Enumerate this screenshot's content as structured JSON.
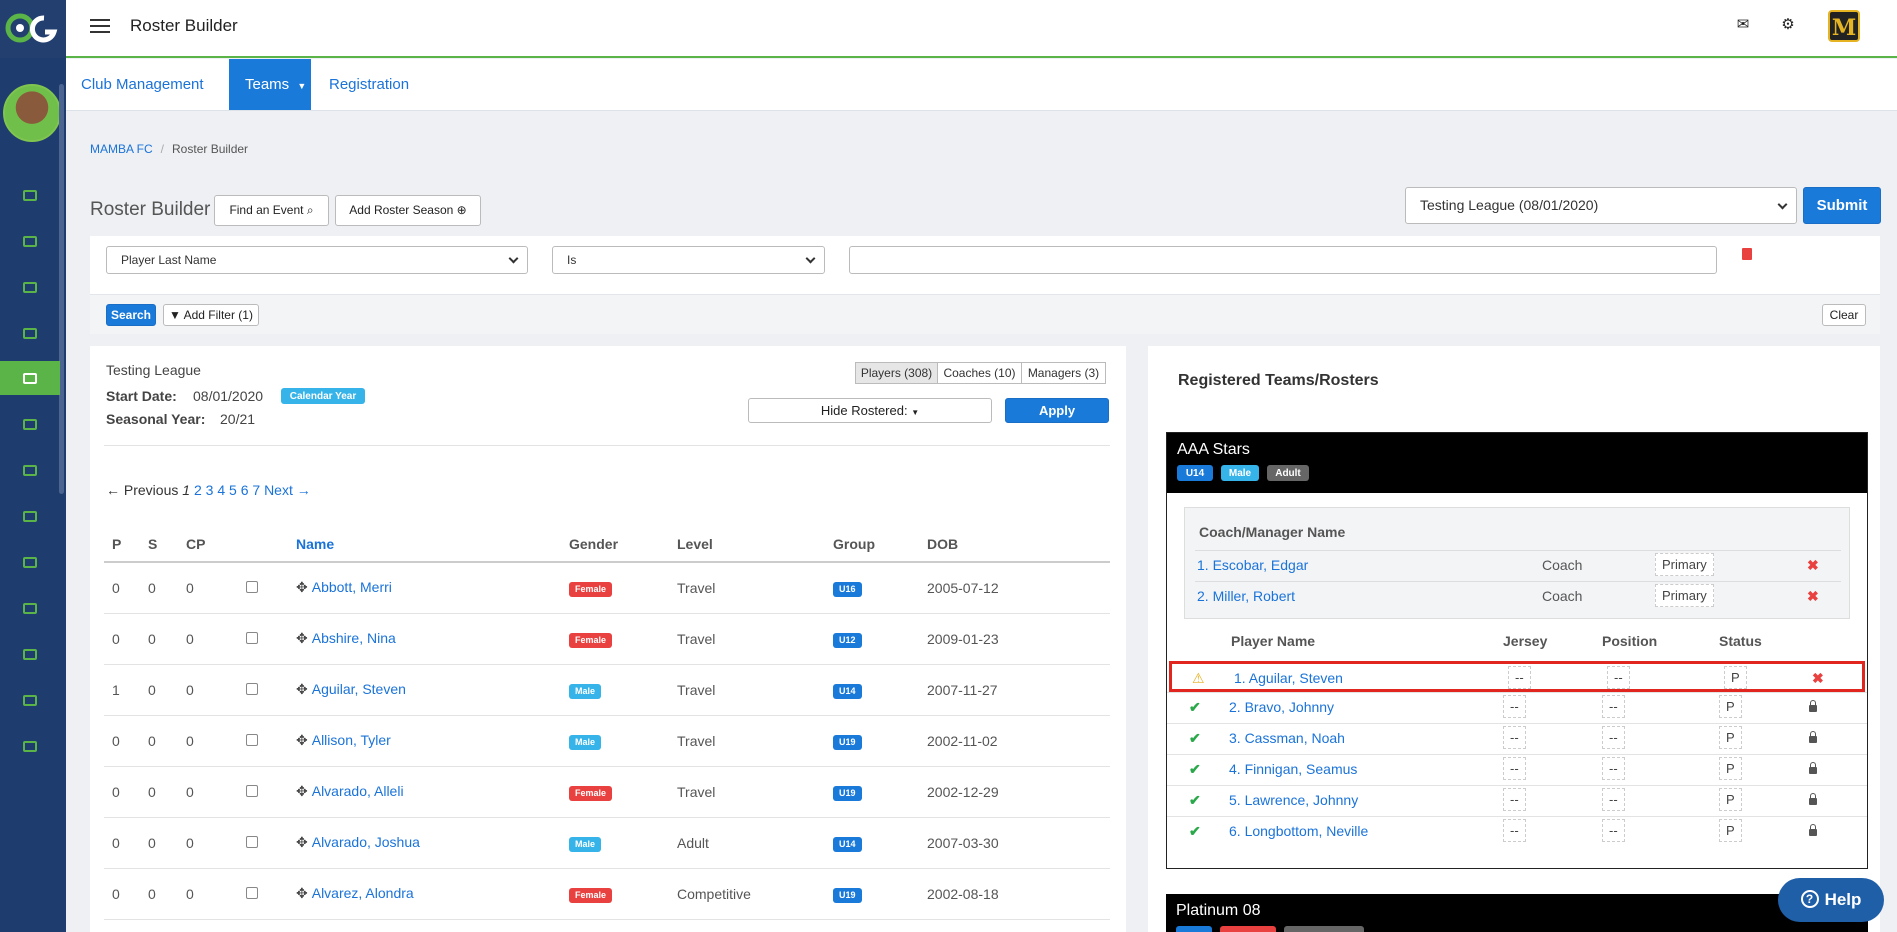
{
  "app": {
    "title": "Roster Builder",
    "brand_letter": "M"
  },
  "tabs": [
    {
      "label": "Club Management"
    },
    {
      "label": "Teams"
    },
    {
      "label": "Registration"
    }
  ],
  "breadcrumb": {
    "root": "MAMBA FC",
    "current": "Roster Builder"
  },
  "heading": {
    "title": "Roster Builder",
    "find_event_label": "Find an Event",
    "add_season_label": "Add Roster Season",
    "league_select": "Testing League (08/01/2020)",
    "submit_label": "Submit"
  },
  "filter": {
    "field": "Player Last Name",
    "operator": "Is",
    "value": "",
    "search_label": "Search",
    "add_filter_label": "Add Filter (1)",
    "clear_label": "Clear"
  },
  "league": {
    "name": "Testing League",
    "start_date_label": "Start Date:",
    "start_date": "08/01/2020",
    "calendar_badge": "Calendar Year",
    "seasonal_year_label": "Seasonal Year:",
    "seasonal_year": "20/21"
  },
  "segments": {
    "players": "Players (308)",
    "coaches": "Coaches (10)",
    "managers": "Managers (3)"
  },
  "hide_rostered": "Hide Rostered:",
  "apply_label": "Apply",
  "pager": {
    "prev": "← Previous",
    "current": "1",
    "pages": [
      "2",
      "3",
      "4",
      "5",
      "6",
      "7"
    ],
    "next": "Next →"
  },
  "players_table": {
    "headers": {
      "p": "P",
      "s": "S",
      "cp": "CP",
      "name": "Name",
      "gender": "Gender",
      "level": "Level",
      "group": "Group",
      "dob": "DOB"
    },
    "rows": [
      {
        "p": "0",
        "s": "0",
        "cp": "0",
        "name": "Abbott, Merri",
        "gender": "Female",
        "level": "Travel",
        "group": "U16",
        "dob": "2005-07-12"
      },
      {
        "p": "0",
        "s": "0",
        "cp": "0",
        "name": "Abshire, Nina",
        "gender": "Female",
        "level": "Travel",
        "group": "U12",
        "dob": "2009-01-23"
      },
      {
        "p": "1",
        "s": "0",
        "cp": "0",
        "name": "Aguilar, Steven",
        "gender": "Male",
        "level": "Travel",
        "group": "U14",
        "dob": "2007-11-27"
      },
      {
        "p": "0",
        "s": "0",
        "cp": "0",
        "name": "Allison, Tyler",
        "gender": "Male",
        "level": "Travel",
        "group": "U19",
        "dob": "2002-11-02"
      },
      {
        "p": "0",
        "s": "0",
        "cp": "0",
        "name": "Alvarado, Alleli",
        "gender": "Female",
        "level": "Travel",
        "group": "U19",
        "dob": "2002-12-29"
      },
      {
        "p": "0",
        "s": "0",
        "cp": "0",
        "name": "Alvarado, Joshua",
        "gender": "Male",
        "level": "Adult",
        "group": "U14",
        "dob": "2007-03-30"
      },
      {
        "p": "0",
        "s": "0",
        "cp": "0",
        "name": "Alvarez, Alondra",
        "gender": "Female",
        "level": "Competitive",
        "group": "U19",
        "dob": "2002-08-18"
      }
    ]
  },
  "right": {
    "title": "Registered Teams/Rosters",
    "team1": {
      "name": "AAA Stars",
      "badges": [
        "U14",
        "Male",
        "Adult"
      ],
      "coach_header": "Coach/Manager Name",
      "coaches": [
        {
          "name": "1. Escobar, Edgar",
          "role": "Coach",
          "type": "Primary"
        },
        {
          "name": "2. Miller, Robert",
          "role": "Coach",
          "type": "Primary"
        }
      ],
      "player_headers": {
        "name": "Player Name",
        "jersey": "Jersey",
        "position": "Position",
        "status": "Status"
      },
      "players": [
        {
          "name": "1. Aguilar, Steven",
          "jersey": "--",
          "position": "--",
          "status": "P"
        },
        {
          "name": "2. Bravo, Johnny",
          "jersey": "--",
          "position": "--",
          "status": "P"
        },
        {
          "name": "3. Cassman, Noah",
          "jersey": "--",
          "position": "--",
          "status": "P"
        },
        {
          "name": "4. Finnigan, Seamus",
          "jersey": "--",
          "position": "--",
          "status": "P"
        },
        {
          "name": "5. Lawrence, Johnny",
          "jersey": "--",
          "position": "--",
          "status": "P"
        },
        {
          "name": "6. Longbottom, Neville",
          "jersey": "--",
          "position": "--",
          "status": "P"
        }
      ]
    },
    "team2": {
      "name": "Platinum 08"
    }
  },
  "help_label": "Help"
}
